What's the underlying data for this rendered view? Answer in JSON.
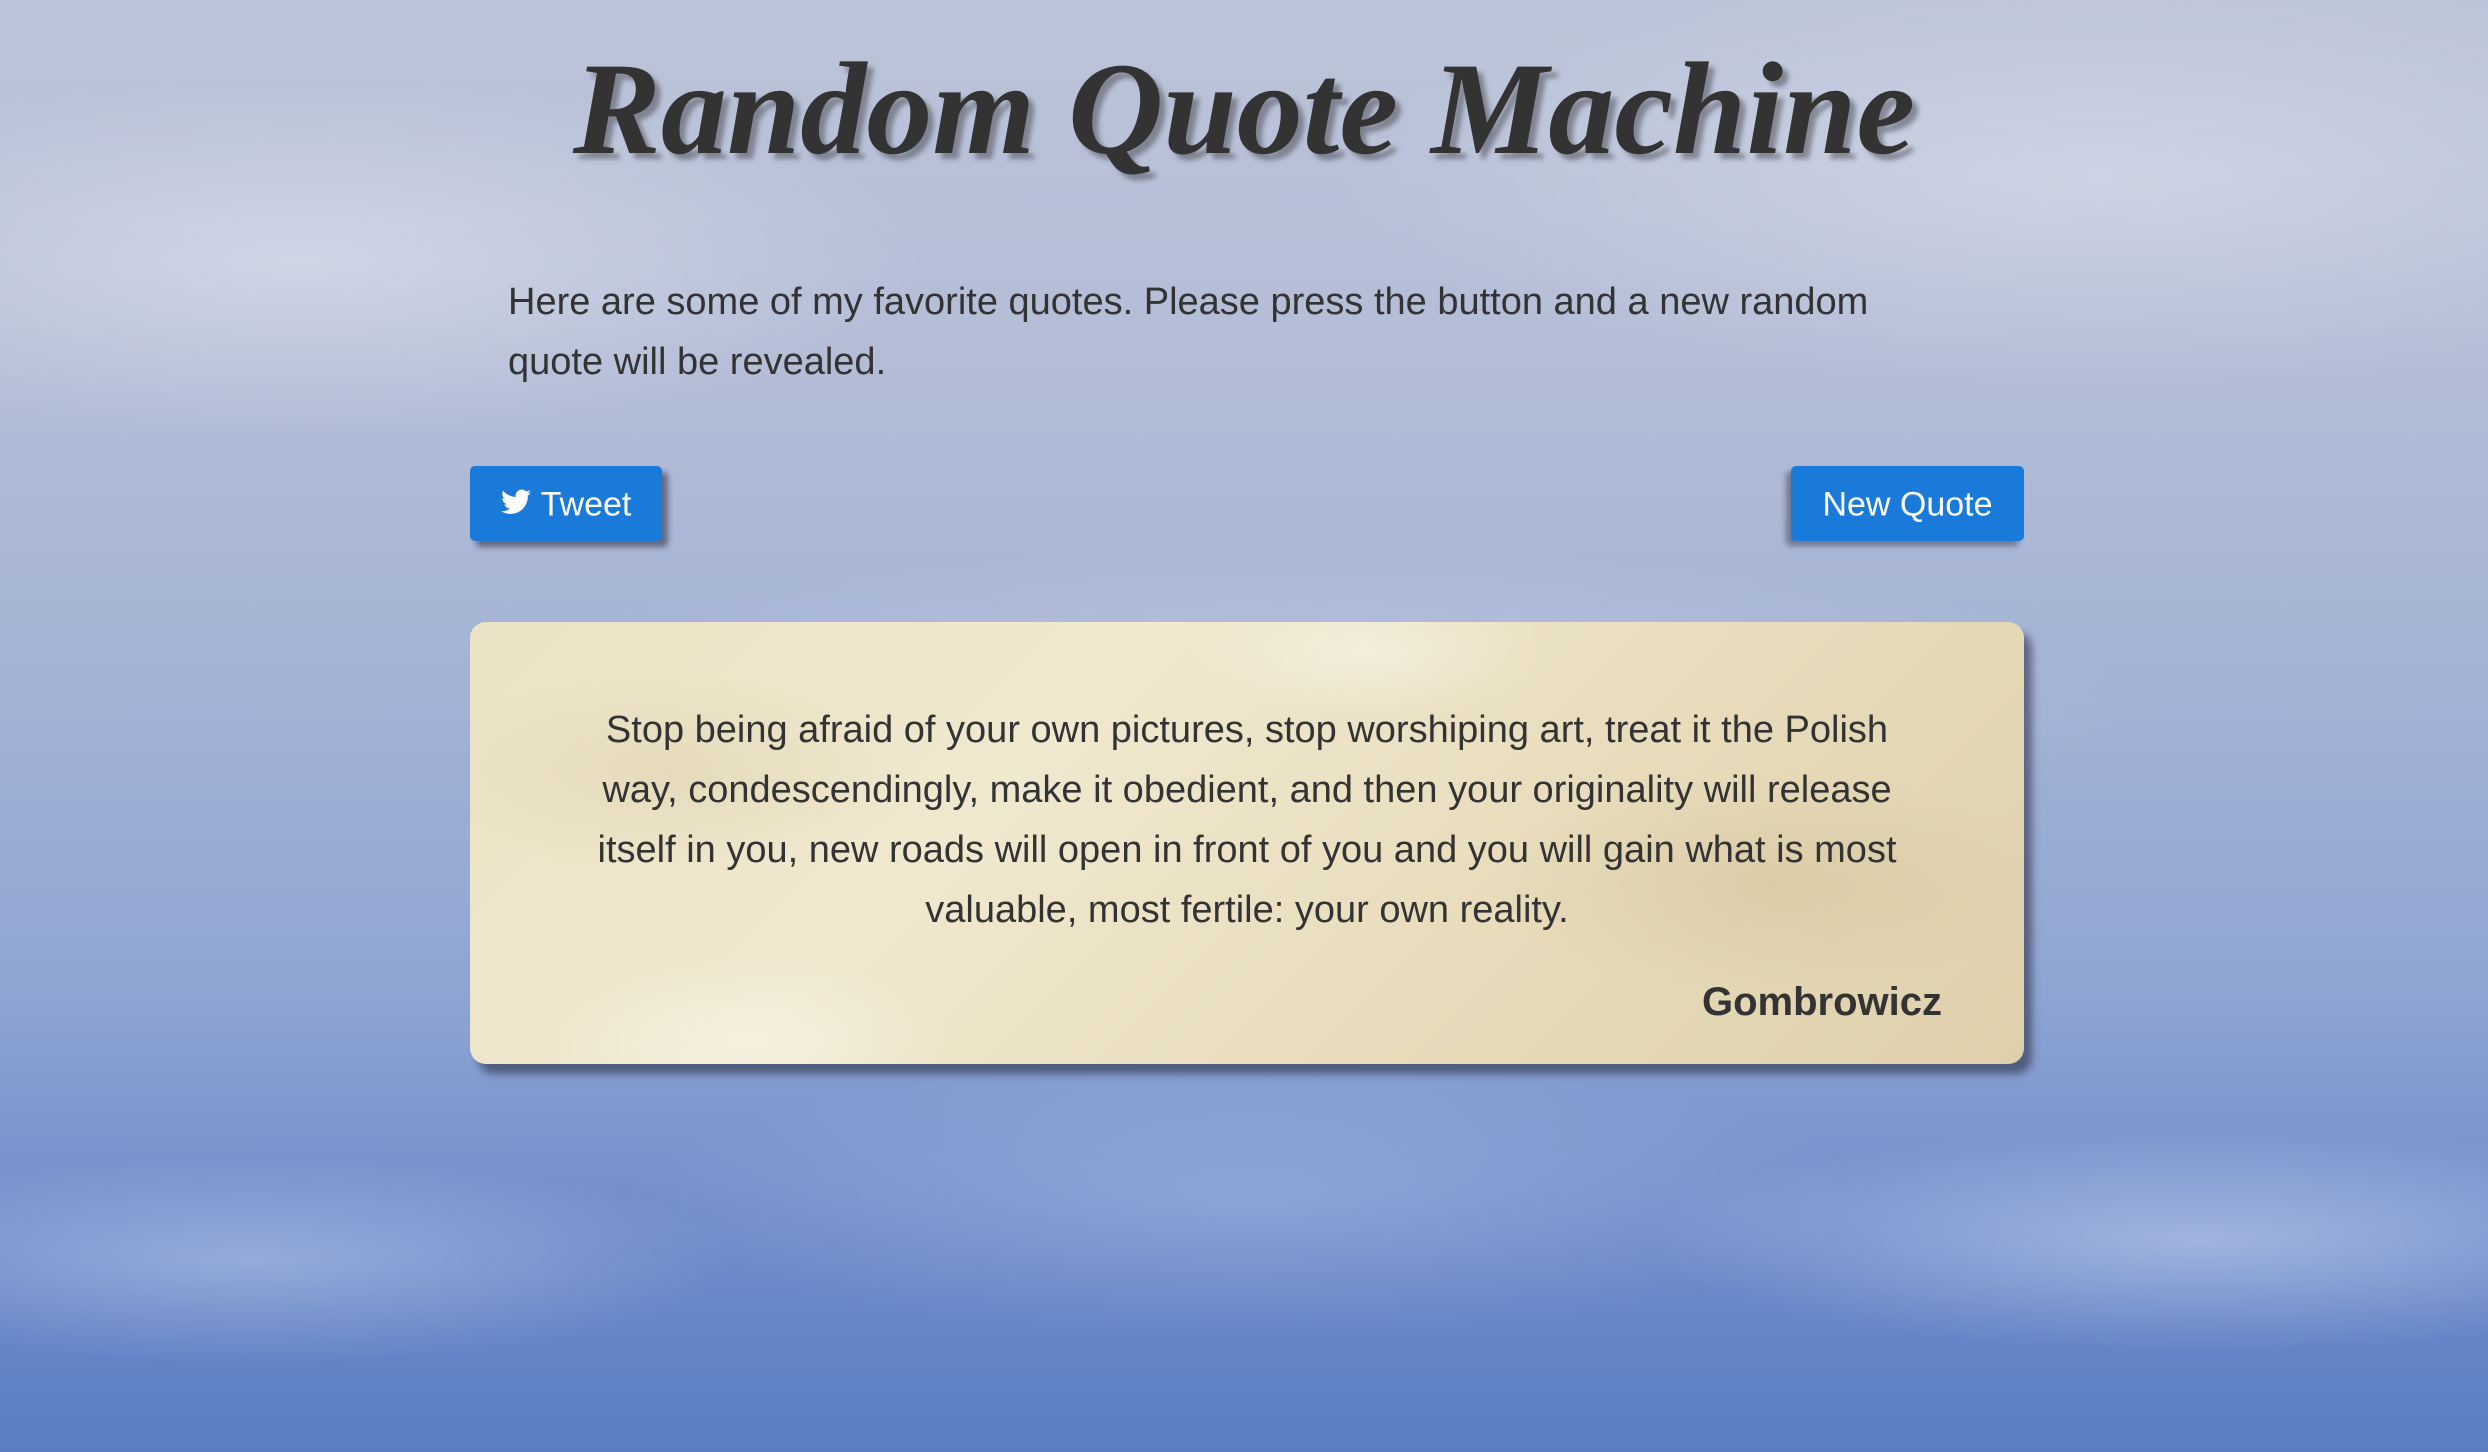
{
  "page": {
    "title": "Random Quote Machine",
    "intro": "Here are some of my favorite quotes. Please press the button and a new random quote will be revealed."
  },
  "buttons": {
    "tweet_label": "Tweet",
    "tweet_icon": "twitter-bird-icon",
    "new_quote_label": "New Quote",
    "color": "#1a7ad9"
  },
  "quote": {
    "text": "Stop being afraid of your own pictures, stop worshiping art, treat it the Polish way, condescendingly, make it obedient, and then your originality will release itself in you, new roads will open in front of you and you will gain what is most valuable, most fertile: your own reality.",
    "author": "Gombrowicz"
  }
}
